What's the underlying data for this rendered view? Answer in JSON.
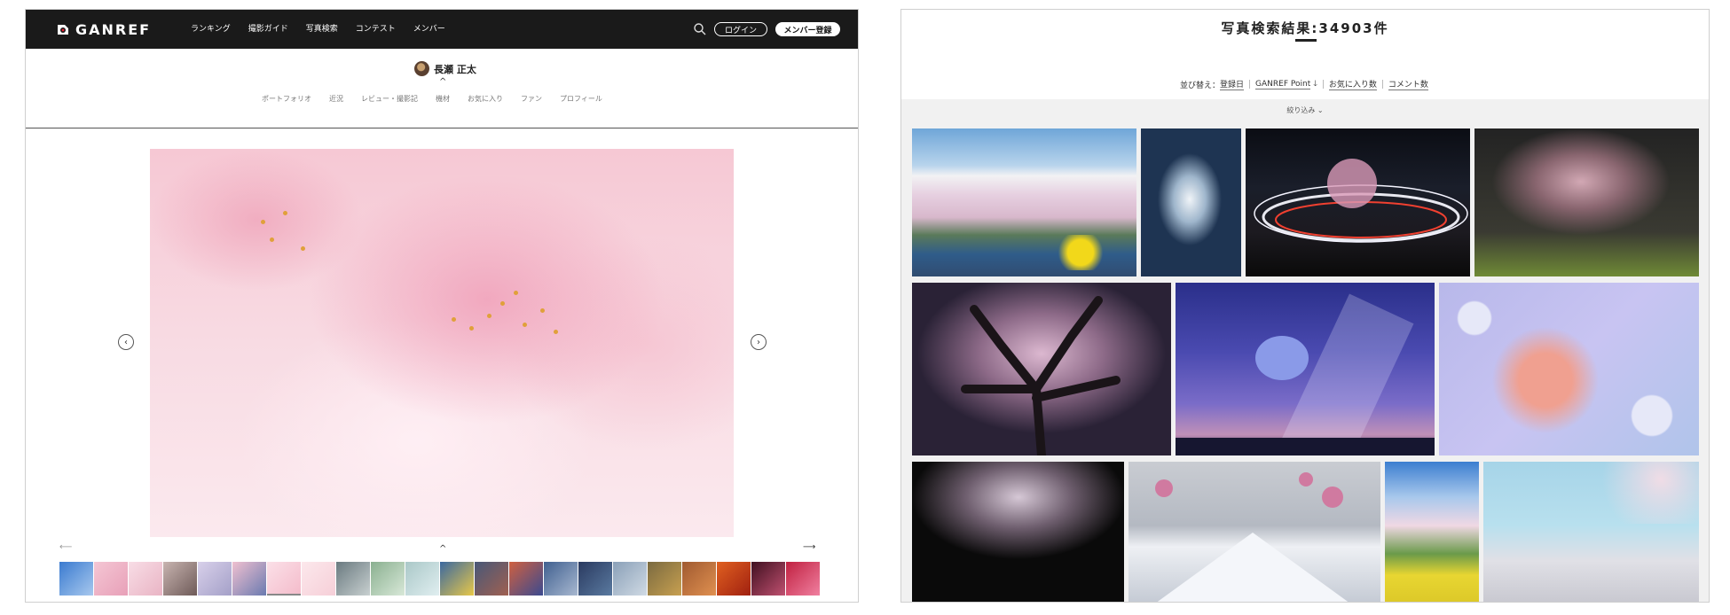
{
  "left_panel": {
    "brand": "GANREF",
    "nav": [
      "ランキング",
      "撮影ガイド",
      "写真検索",
      "コンテスト",
      "メンバー"
    ],
    "login_label": "ログイン",
    "signup_label": "メンバー登録",
    "author_name": "長瀬 正太",
    "collapse_glyph": "^",
    "profile_tabs": [
      "ポートフォリオ",
      "近況",
      "レビュー・撮影記",
      "機材",
      "お気に入り",
      "ファン",
      "プロフィール"
    ],
    "prev_glyph": "‹",
    "next_glyph": "›",
    "strip_prev_glyph": "⟵",
    "strip_next_glyph": "⟶",
    "strip_up_glyph": "^",
    "thumb_count": 22,
    "active_thumb": 6
  },
  "right_panel": {
    "results_title": "写真検索結果:34903件",
    "sort_label": "並び替え：",
    "sort_options": [
      "登録日",
      "GANREF Point",
      "お気に入り数",
      "コメント数"
    ],
    "sort_arrow": "🡓",
    "filter_label": "絞り込み",
    "filter_chevron": "⌄"
  },
  "colors": {
    "header_bg": "#1a1a1a",
    "accent_pink": "#f6c8d4",
    "filter_bg": "#f1f1f1"
  }
}
